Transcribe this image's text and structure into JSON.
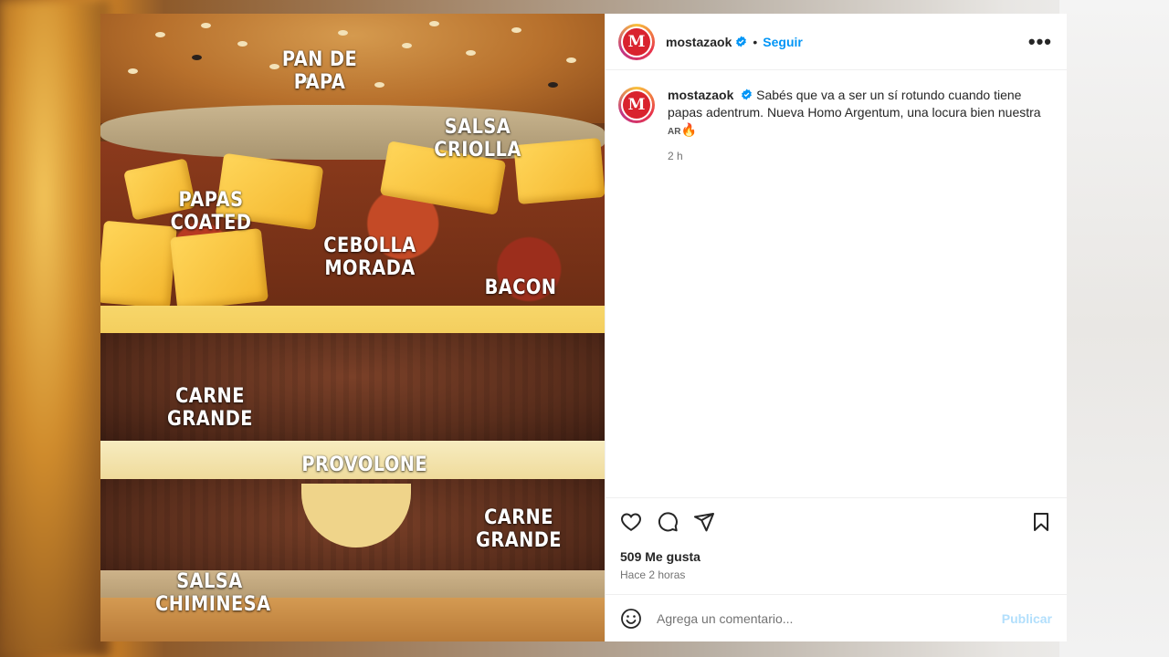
{
  "post": {
    "media_labels": {
      "pan_de_papa": "PAN DE\nPAPA",
      "salsa_criolla": "SALSA\nCRIOLLA",
      "papas_coated": "PAPAS\nCOATED",
      "cebolla_morada": "CEBOLLA\nMORADA",
      "bacon": "BACON",
      "carne_grande_1": "CARNE\nGRANDE",
      "provolone": "PROVOLONE",
      "carne_grande_2": "CARNE\nGRANDE",
      "salsa_chiminesa": "SALSA\nCHIMINESA"
    }
  },
  "header": {
    "avatar_letter": "M",
    "username": "mostazaok",
    "separator": "•",
    "follow_label": "Seguir",
    "more_label": "•••"
  },
  "caption": {
    "username": "mostazaok",
    "text": "Sabés que va a ser un sí rotundo cuando tiene papas adentrum. Nueva Homo Argentum, una locura bien nuestra",
    "flag": "AR",
    "emoji": "🔥",
    "time": "2 h"
  },
  "actions": {
    "likes": "509 Me gusta",
    "posted": "Hace 2 horas"
  },
  "comment": {
    "placeholder": "Agrega un comentario...",
    "publish_label": "Publicar"
  },
  "colors": {
    "accent": "#0095f6",
    "brand_red": "#d9232e",
    "publish_disabled": "#b2dffc"
  },
  "icons": [
    "verified-icon",
    "more-icon",
    "heart-icon",
    "comment-icon",
    "share-icon",
    "bookmark-icon",
    "emoji-icon"
  ]
}
